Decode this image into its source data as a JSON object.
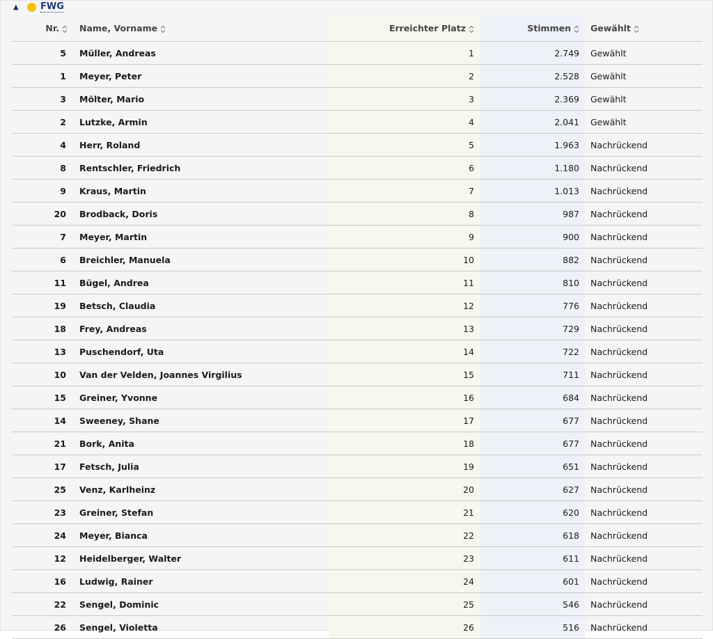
{
  "party": {
    "toggle_icon": "▲",
    "name": "FWG",
    "dot_color": "#f6c200"
  },
  "columns": {
    "nr": "Nr.",
    "name": "Name, Vorname",
    "platz": "Erreichter Platz",
    "stimmen": "Stimmen",
    "gewaehlt": "Gewählt"
  },
  "rows": [
    {
      "nr": "5",
      "name": "Müller, Andreas",
      "platz": "1",
      "stimmen": "2.749",
      "status": "Gewählt"
    },
    {
      "nr": "1",
      "name": "Meyer, Peter",
      "platz": "2",
      "stimmen": "2.528",
      "status": "Gewählt"
    },
    {
      "nr": "3",
      "name": "Mölter, Mario",
      "platz": "3",
      "stimmen": "2.369",
      "status": "Gewählt"
    },
    {
      "nr": "2",
      "name": "Lutzke, Armin",
      "platz": "4",
      "stimmen": "2.041",
      "status": "Gewählt"
    },
    {
      "nr": "4",
      "name": "Herr, Roland",
      "platz": "5",
      "stimmen": "1.963",
      "status": "Nachrückend"
    },
    {
      "nr": "8",
      "name": "Rentschler, Friedrich",
      "platz": "6",
      "stimmen": "1.180",
      "status": "Nachrückend"
    },
    {
      "nr": "9",
      "name": "Kraus, Martin",
      "platz": "7",
      "stimmen": "1.013",
      "status": "Nachrückend"
    },
    {
      "nr": "20",
      "name": "Brodback, Doris",
      "platz": "8",
      "stimmen": "987",
      "status": "Nachrückend"
    },
    {
      "nr": "7",
      "name": "Meyer, Martin",
      "platz": "9",
      "stimmen": "900",
      "status": "Nachrückend"
    },
    {
      "nr": "6",
      "name": "Breichler, Manuela",
      "platz": "10",
      "stimmen": "882",
      "status": "Nachrückend"
    },
    {
      "nr": "11",
      "name": "Bügel, Andrea",
      "platz": "11",
      "stimmen": "810",
      "status": "Nachrückend"
    },
    {
      "nr": "19",
      "name": "Betsch, Claudia",
      "platz": "12",
      "stimmen": "776",
      "status": "Nachrückend"
    },
    {
      "nr": "18",
      "name": "Frey, Andreas",
      "platz": "13",
      "stimmen": "729",
      "status": "Nachrückend"
    },
    {
      "nr": "13",
      "name": "Puschendorf, Uta",
      "platz": "14",
      "stimmen": "722",
      "status": "Nachrückend"
    },
    {
      "nr": "10",
      "name": "Van der Velden, Joannes Virgilius",
      "platz": "15",
      "stimmen": "711",
      "status": "Nachrückend"
    },
    {
      "nr": "15",
      "name": "Greiner, Yvonne",
      "platz": "16",
      "stimmen": "684",
      "status": "Nachrückend"
    },
    {
      "nr": "14",
      "name": "Sweeney, Shane",
      "platz": "17",
      "stimmen": "677",
      "status": "Nachrückend"
    },
    {
      "nr": "21",
      "name": "Bork, Anita",
      "platz": "18",
      "stimmen": "677",
      "status": "Nachrückend"
    },
    {
      "nr": "17",
      "name": "Fetsch, Julia",
      "platz": "19",
      "stimmen": "651",
      "status": "Nachrückend"
    },
    {
      "nr": "25",
      "name": "Venz, Karlheinz",
      "platz": "20",
      "stimmen": "627",
      "status": "Nachrückend"
    },
    {
      "nr": "23",
      "name": "Greiner, Stefan",
      "platz": "21",
      "stimmen": "620",
      "status": "Nachrückend"
    },
    {
      "nr": "24",
      "name": "Meyer, Bianca",
      "platz": "22",
      "stimmen": "618",
      "status": "Nachrückend"
    },
    {
      "nr": "12",
      "name": "Heidelberger, Walter",
      "platz": "23",
      "stimmen": "611",
      "status": "Nachrückend"
    },
    {
      "nr": "16",
      "name": "Ludwig, Rainer",
      "platz": "24",
      "stimmen": "601",
      "status": "Nachrückend"
    },
    {
      "nr": "22",
      "name": "Sengel, Dominic",
      "platz": "25",
      "stimmen": "546",
      "status": "Nachrückend"
    },
    {
      "nr": "26",
      "name": "Sengel, Violetta",
      "platz": "26",
      "stimmen": "516",
      "status": "Nachrückend"
    }
  ]
}
